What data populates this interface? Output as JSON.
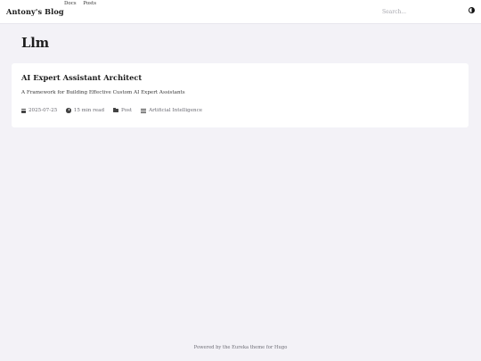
{
  "header": {
    "brand": "Antony's Blog",
    "nav": [
      "Docs",
      "Posts"
    ],
    "search_placeholder": "Search...",
    "theme_toggle_icon": "half-circle-contrast-icon"
  },
  "main": {
    "title": "Llm",
    "posts": [
      {
        "title": "AI Expert Assistant Architect",
        "summary": "A Framework for Building Effective Custom AI Expert Assistants",
        "date": "2025-07-25",
        "read_time": "15 min read",
        "type": "Post",
        "category": "Artificial Intelligence"
      }
    ]
  },
  "footer": {
    "text": "Powered by the Eureka theme for Hugo"
  },
  "colors": {
    "background": "#f3f2f7",
    "card": "#ffffff",
    "text": "#1c1c1c",
    "meta": "#6b6b73"
  }
}
